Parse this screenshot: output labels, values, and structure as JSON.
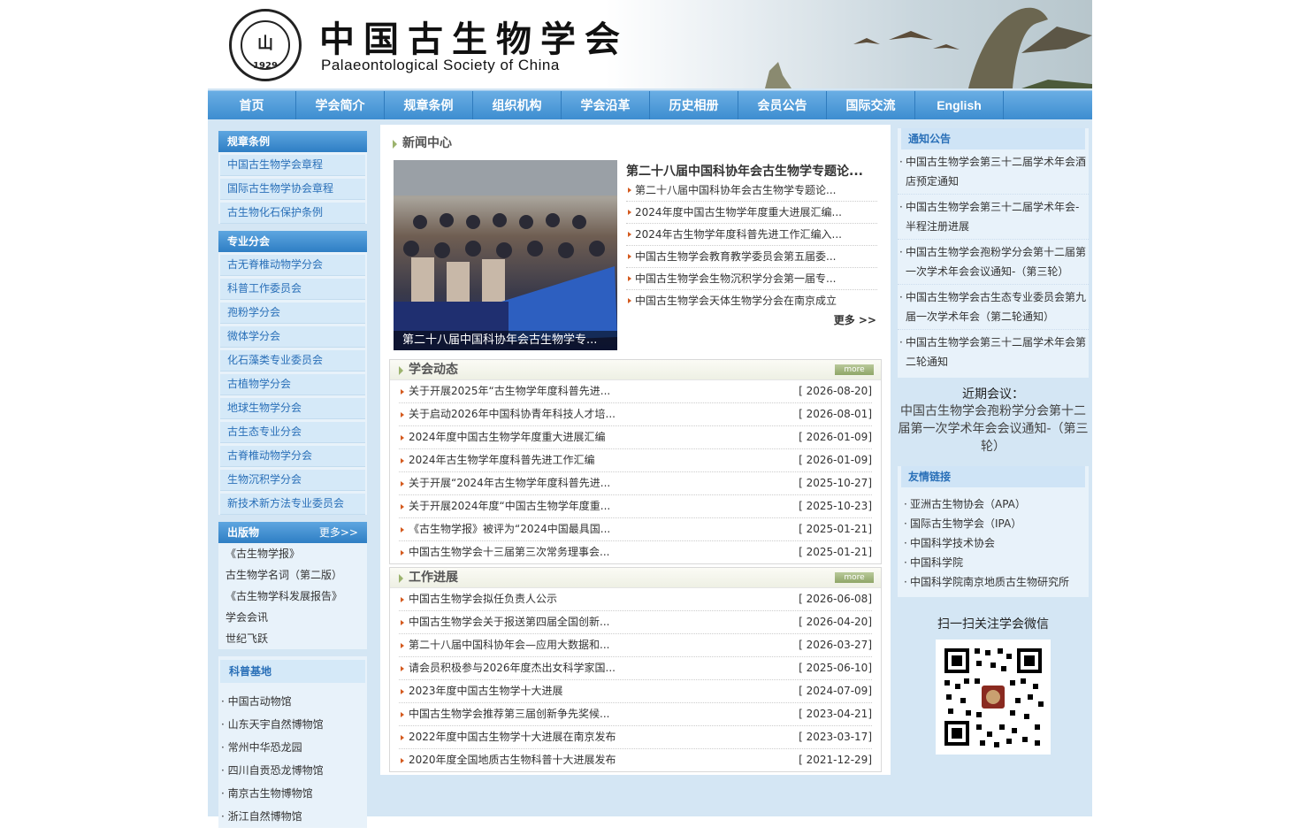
{
  "header": {
    "title_cn": "中国古生物学会",
    "title_en": "Palaeontological Society of China",
    "logo_year": "1929"
  },
  "nav": [
    "首页",
    "学会简介",
    "规章条例",
    "组织机构",
    "学会沿革",
    "历史相册",
    "会员公告",
    "国际交流",
    "English"
  ],
  "left": {
    "rules": {
      "title": "规章条例",
      "items": [
        "中国古生物学会章程",
        "国际古生物学协会章程",
        "古生物化石保护条例"
      ]
    },
    "branches": {
      "title": "专业分会",
      "items": [
        "古无脊椎动物学分会",
        "科普工作委员会",
        "孢粉学分会",
        "微体学分会",
        "化石藻类专业委员会",
        "古植物学分会",
        "地球生物学分会",
        "古生态专业分会",
        "古脊椎动物学分会",
        "生物沉积学分会",
        "新技术新方法专业委员会"
      ]
    },
    "publications": {
      "title": "出版物",
      "more": "更多>>",
      "items": [
        "《古生物学报》",
        "古生物学名词（第二版）",
        "《古生物学科发展报告》",
        "学会会讯",
        "世纪飞跃"
      ]
    },
    "bases": {
      "title": "科普基地",
      "items": [
        "中国古动物馆",
        "山东天宇自然博物馆",
        "常州中华恐龙园",
        "四川自贡恐龙博物馆",
        "南京古生物博物馆",
        "浙江自然博物馆"
      ]
    }
  },
  "news": {
    "title": "新闻中心",
    "photo_caption": "第二十八届中国科协年会古生物学专...",
    "headline": "第二十八届中国科协年会古生物学专题论...",
    "items": [
      "第二十八届中国科协年会古生物学专题论...",
      "2024年度中国古生物学年度重大进展汇编...",
      "2024年古生物学年度科普先进工作汇编入...",
      "中国古生物学会教育教学委员会第五届委...",
      "中国古生物学会生物沉积学分会第一届专...",
      "中国古生物学会天体生物学分会在南京成立"
    ],
    "more": "更多 >>"
  },
  "dynamics": {
    "title": "学会动态",
    "more": "more",
    "rows": [
      {
        "t": "关于开展2025年“古生物学年度科普先进...",
        "d": "[ 2026-08-20]"
      },
      {
        "t": "关于启动2026年中国科协青年科技人才培...",
        "d": "[ 2026-08-01]"
      },
      {
        "t": "2024年度中国古生物学年度重大进展汇编",
        "d": "[ 2026-01-09]"
      },
      {
        "t": "2024年古生物学年度科普先进工作汇编",
        "d": "[ 2026-01-09]"
      },
      {
        "t": "关于开展“2024年古生物学年度科普先进...",
        "d": "[ 2025-10-27]"
      },
      {
        "t": "关于开展2024年度“中国古生物学年度重...",
        "d": "[ 2025-10-23]"
      },
      {
        "t": "《古生物学报》被评为“2024中国最具国...",
        "d": "[ 2025-01-21]"
      },
      {
        "t": "中国古生物学会十三届第三次常务理事会...",
        "d": "[ 2025-01-21]"
      }
    ]
  },
  "work": {
    "title": "工作进展",
    "more": "more",
    "rows": [
      {
        "t": "中国古生物学会拟任负责人公示",
        "d": "[ 2026-06-08]"
      },
      {
        "t": "中国古生物学会关于报送第四届全国创新...",
        "d": "[ 2026-04-20]"
      },
      {
        "t": "第二十八届中国科协年会—应用大数据和...",
        "d": "[ 2026-03-27]"
      },
      {
        "t": "请会员积极参与2026年度杰出女科学家国...",
        "d": "[ 2025-06-10]"
      },
      {
        "t": "2023年度中国古生物学十大进展",
        "d": "[ 2024-07-09]"
      },
      {
        "t": "中国古生物学会推荐第三届创新争先奖候...",
        "d": "[ 2023-04-21]"
      },
      {
        "t": "2022年度中国古生物学十大进展在南京发布",
        "d": "[ 2023-03-17]"
      },
      {
        "t": "2020年度全国地质古生物科普十大进展发布",
        "d": "[ 2021-12-29]"
      }
    ]
  },
  "notice": {
    "title": "通知公告",
    "items": [
      "中国古生物学会第三十二届学术年会酒店预定通知",
      "中国古生物学会第三十二届学术年会-半程注册进展",
      "中国古生物学会孢粉学分会第十二届第一次学术年会会议通知-（第三轮）",
      "中国古生物学会古生态专业委员会第九届一次学术年会（第二轮通知）",
      "中国古生物学会第三十二届学术年会第二轮通知"
    ]
  },
  "meeting": {
    "label": "近期会议：",
    "text": "中国古生物学会孢粉学分会第十二届第一次学术年会会议通知-（第三轮）"
  },
  "links": {
    "title": "友情链接",
    "items": [
      "亚洲古生物协会（APA）",
      "国际古生物学会（IPA）",
      "中国科学技术协会",
      "中国科学院",
      "中国科学院南京地质古生物研究所"
    ]
  },
  "wechat": {
    "label": "扫一扫关注学会微信"
  }
}
